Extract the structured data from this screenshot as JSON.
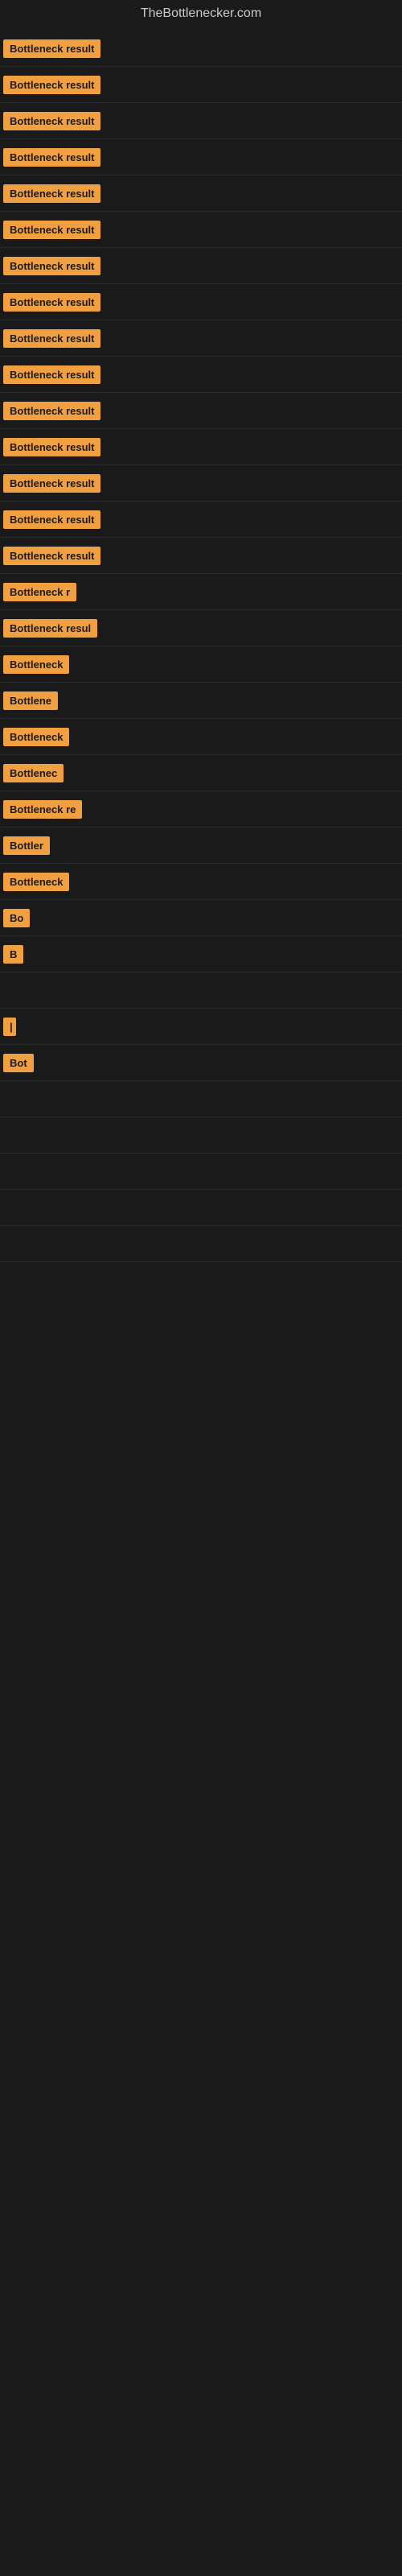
{
  "site": {
    "title": "TheBottlenecker.com"
  },
  "rows": [
    {
      "id": 1,
      "label": "Bottleneck result",
      "width": 140
    },
    {
      "id": 2,
      "label": "Bottleneck result",
      "width": 140
    },
    {
      "id": 3,
      "label": "Bottleneck result",
      "width": 140
    },
    {
      "id": 4,
      "label": "Bottleneck result",
      "width": 140
    },
    {
      "id": 5,
      "label": "Bottleneck result",
      "width": 140
    },
    {
      "id": 6,
      "label": "Bottleneck result",
      "width": 140
    },
    {
      "id": 7,
      "label": "Bottleneck result",
      "width": 140
    },
    {
      "id": 8,
      "label": "Bottleneck result",
      "width": 140
    },
    {
      "id": 9,
      "label": "Bottleneck result",
      "width": 140
    },
    {
      "id": 10,
      "label": "Bottleneck result",
      "width": 140
    },
    {
      "id": 11,
      "label": "Bottleneck result",
      "width": 140
    },
    {
      "id": 12,
      "label": "Bottleneck result",
      "width": 140
    },
    {
      "id": 13,
      "label": "Bottleneck result",
      "width": 140
    },
    {
      "id": 14,
      "label": "Bottleneck result",
      "width": 140
    },
    {
      "id": 15,
      "label": "Bottleneck result",
      "width": 130
    },
    {
      "id": 16,
      "label": "Bottleneck r",
      "width": 100
    },
    {
      "id": 17,
      "label": "Bottleneck resul",
      "width": 115
    },
    {
      "id": 18,
      "label": "Bottleneck",
      "width": 85
    },
    {
      "id": 19,
      "label": "Bottlene",
      "width": 70
    },
    {
      "id": 20,
      "label": "Bottleneck",
      "width": 85
    },
    {
      "id": 21,
      "label": "Bottlenec",
      "width": 78
    },
    {
      "id": 22,
      "label": "Bottleneck re",
      "width": 105
    },
    {
      "id": 23,
      "label": "Bottler",
      "width": 60
    },
    {
      "id": 24,
      "label": "Bottleneck",
      "width": 85
    },
    {
      "id": 25,
      "label": "Bo",
      "width": 28
    },
    {
      "id": 26,
      "label": "B",
      "width": 16
    },
    {
      "id": 27,
      "label": "",
      "width": 4
    },
    {
      "id": 28,
      "label": "|",
      "width": 8
    },
    {
      "id": 29,
      "label": "Bot",
      "width": 32
    },
    {
      "id": 30,
      "label": "",
      "width": 0
    },
    {
      "id": 31,
      "label": "",
      "width": 0
    },
    {
      "id": 32,
      "label": "",
      "width": 0
    },
    {
      "id": 33,
      "label": "",
      "width": 0
    },
    {
      "id": 34,
      "label": "",
      "width": 0
    }
  ]
}
